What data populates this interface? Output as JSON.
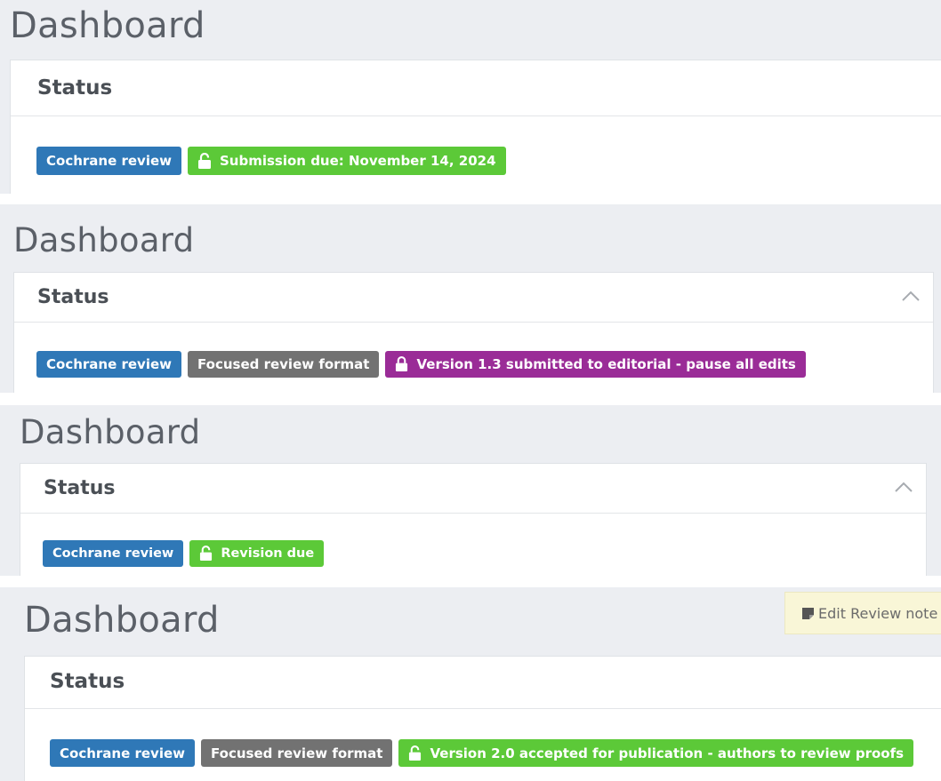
{
  "panels": [
    {
      "title": "Dashboard",
      "status_heading": "Status",
      "badges": [
        {
          "label": "Cochrane review",
          "color": "blue"
        },
        {
          "label": "Submission due: November 14, 2024",
          "color": "green",
          "icon": "unlock-icon"
        }
      ]
    },
    {
      "title": "Dashboard",
      "status_heading": "Status",
      "collapse_icon": "chevron-up-icon",
      "badges": [
        {
          "label": "Cochrane review",
          "color": "blue"
        },
        {
          "label": "Focused review format",
          "color": "gray"
        },
        {
          "label": "Version 1.3 submitted to editorial - pause all edits",
          "color": "purple",
          "icon": "lock-icon"
        }
      ]
    },
    {
      "title": "Dashboard",
      "status_heading": "Status",
      "collapse_icon": "chevron-up-icon",
      "badges": [
        {
          "label": "Cochrane review",
          "color": "blue"
        },
        {
          "label": "Revision due",
          "color": "green",
          "icon": "unlock-icon"
        }
      ]
    },
    {
      "title": "Dashboard",
      "status_heading": "Status",
      "edit_note_button": {
        "label": "Edit Review note",
        "icon": "note-icon"
      },
      "badges": [
        {
          "label": "Cochrane review",
          "color": "blue"
        },
        {
          "label": "Focused review format",
          "color": "gray"
        },
        {
          "label": "Version 2.0 accepted for publication - authors to review proofs",
          "color": "green",
          "icon": "unlock-icon"
        }
      ]
    }
  ],
  "colors": {
    "blue": "#2f78b7",
    "gray": "#727272",
    "green": "#5cc938",
    "purple": "#9a2c97",
    "background": "#eceef2"
  }
}
